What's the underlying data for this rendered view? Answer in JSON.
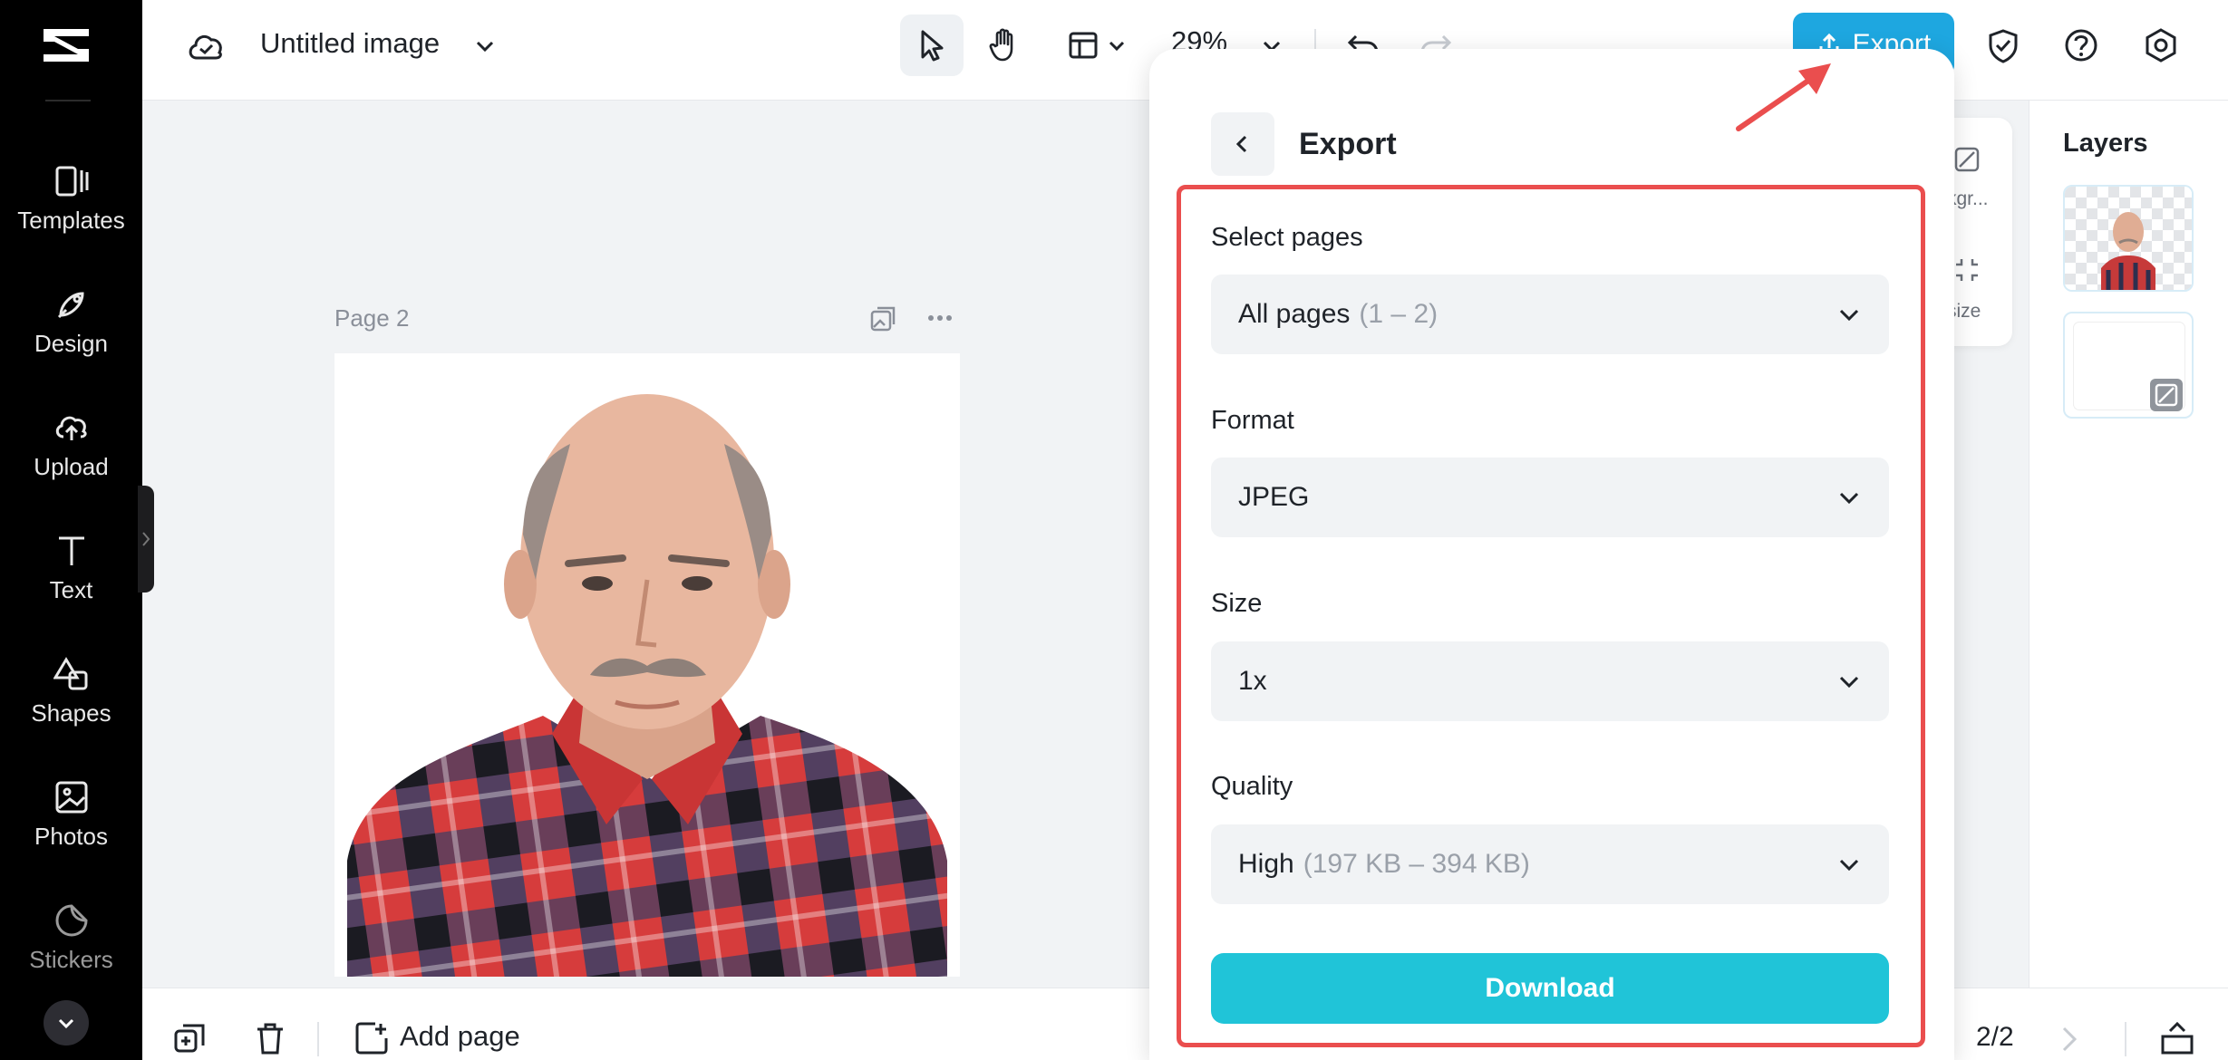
{
  "sidebar": {
    "items": [
      {
        "label": "Templates",
        "icon": "templates-icon"
      },
      {
        "label": "Design",
        "icon": "design-icon"
      },
      {
        "label": "Upload",
        "icon": "upload-icon"
      },
      {
        "label": "Text",
        "icon": "text-icon"
      },
      {
        "label": "Shapes",
        "icon": "shapes-icon"
      },
      {
        "label": "Photos",
        "icon": "photos-icon"
      },
      {
        "label": "Stickers",
        "icon": "stickers-icon"
      }
    ]
  },
  "header": {
    "title": "Untitled image",
    "zoom": "29%",
    "export_label": "Export"
  },
  "canvas": {
    "page_label": "Page 2"
  },
  "side_tools": {
    "background_label": "kgr...",
    "resize_label": "size"
  },
  "layers": {
    "title": "Layers"
  },
  "bottom": {
    "add_page_label": "Add page",
    "page_count": "2/2"
  },
  "export_panel": {
    "title": "Export",
    "pages": {
      "label": "Select pages",
      "value": "All pages",
      "detail": "(1 – 2)"
    },
    "format": {
      "label": "Format",
      "value": "JPEG"
    },
    "size": {
      "label": "Size",
      "value": "1x"
    },
    "quality": {
      "label": "Quality",
      "value": "High",
      "detail": "(197 KB – 394 KB)"
    },
    "download_label": "Download"
  },
  "colors": {
    "accent": "#1ea7e0",
    "download": "#20c4d8",
    "highlight": "#ea4e4e"
  }
}
